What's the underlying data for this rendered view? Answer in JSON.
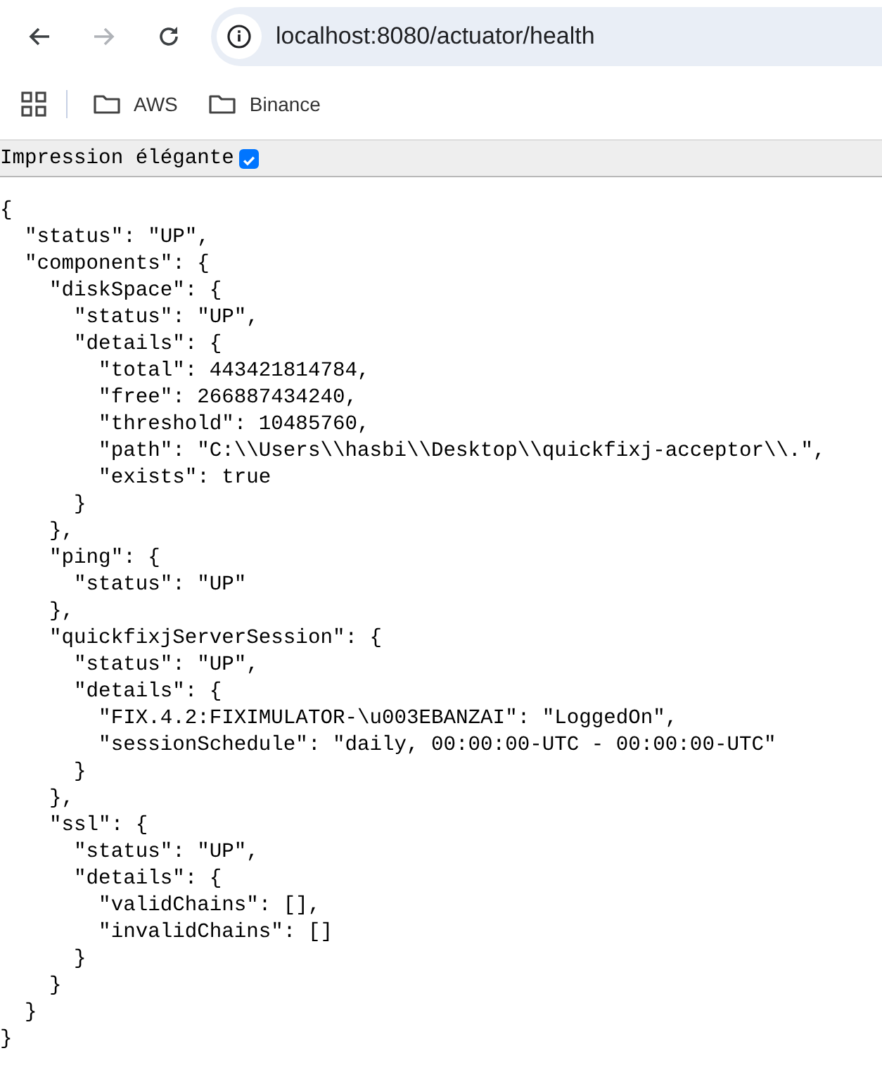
{
  "browser": {
    "address": "localhost:8080/actuator/health",
    "forward_disabled": true,
    "bookmarks": [
      {
        "label": "AWS"
      },
      {
        "label": "Binance"
      }
    ]
  },
  "pretty_print": {
    "label": "Impression élégante",
    "checked": true
  },
  "body_lines": [
    "{",
    "  \"status\": \"UP\",",
    "  \"components\": {",
    "    \"diskSpace\": {",
    "      \"status\": \"UP\",",
    "      \"details\": {",
    "        \"total\": 443421814784,",
    "        \"free\": 266887434240,",
    "        \"threshold\": 10485760,",
    "        \"path\": \"C:\\\\Users\\\\hasbi\\\\Desktop\\\\quickfixj-acceptor\\\\.\",",
    "        \"exists\": true",
    "      }",
    "    },",
    "    \"ping\": {",
    "      \"status\": \"UP\"",
    "    },",
    "    \"quickfixjServerSession\": {",
    "      \"status\": \"UP\",",
    "      \"details\": {",
    "        \"FIX.4.2:FIXIMULATOR-\\u003EBANZAI\": \"LoggedOn\",",
    "        \"sessionSchedule\": \"daily, 00:00:00-UTC - 00:00:00-UTC\"",
    "      }",
    "    },",
    "    \"ssl\": {",
    "      \"status\": \"UP\",",
    "      \"details\": {",
    "        \"validChains\": [],",
    "        \"invalidChains\": []",
    "      }",
    "    }",
    "  }",
    "}"
  ]
}
